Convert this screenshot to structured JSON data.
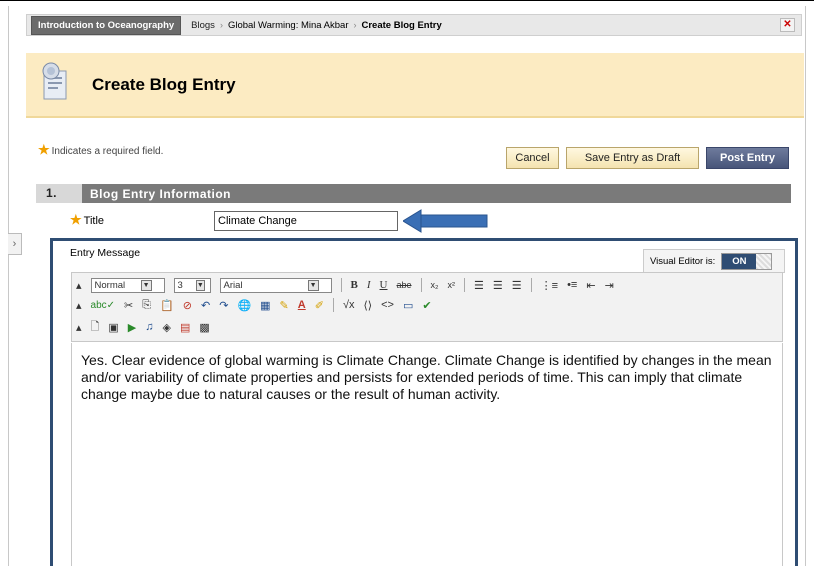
{
  "breadcrumb": {
    "course": "Introduction to Oceanography",
    "items": [
      "Blogs",
      "Global Warming: Mina Akbar"
    ],
    "current": "Create Blog Entry"
  },
  "page": {
    "title": "Create Blog Entry",
    "required_note": "Indicates a required field."
  },
  "buttons": {
    "cancel": "Cancel",
    "save_draft": "Save Entry as Draft",
    "post": "Post Entry"
  },
  "section": {
    "number": "1.",
    "label": "Blog Entry Information"
  },
  "form": {
    "title_label": "Title",
    "title_value": "Climate Change",
    "entry_message_label": "Entry Message"
  },
  "editor": {
    "visual_editor_label": "Visual Editor is:",
    "visual_editor_state": "ON",
    "format_select": "Normal",
    "size_select": "3",
    "font_select": "Arial",
    "body_text": "Yes. Clear evidence of global warming is Climate Change. Climate Change is identified by changes in the mean and/or variability of climate properties and persists for extended periods of time. This can imply that climate change maybe due to natural causes or the result of human activity."
  },
  "colors": {
    "accent": "#2f4d73",
    "title_band": "#fcebc2",
    "section_bar": "#7a7a7a",
    "arrow": "#3a6fb5"
  }
}
